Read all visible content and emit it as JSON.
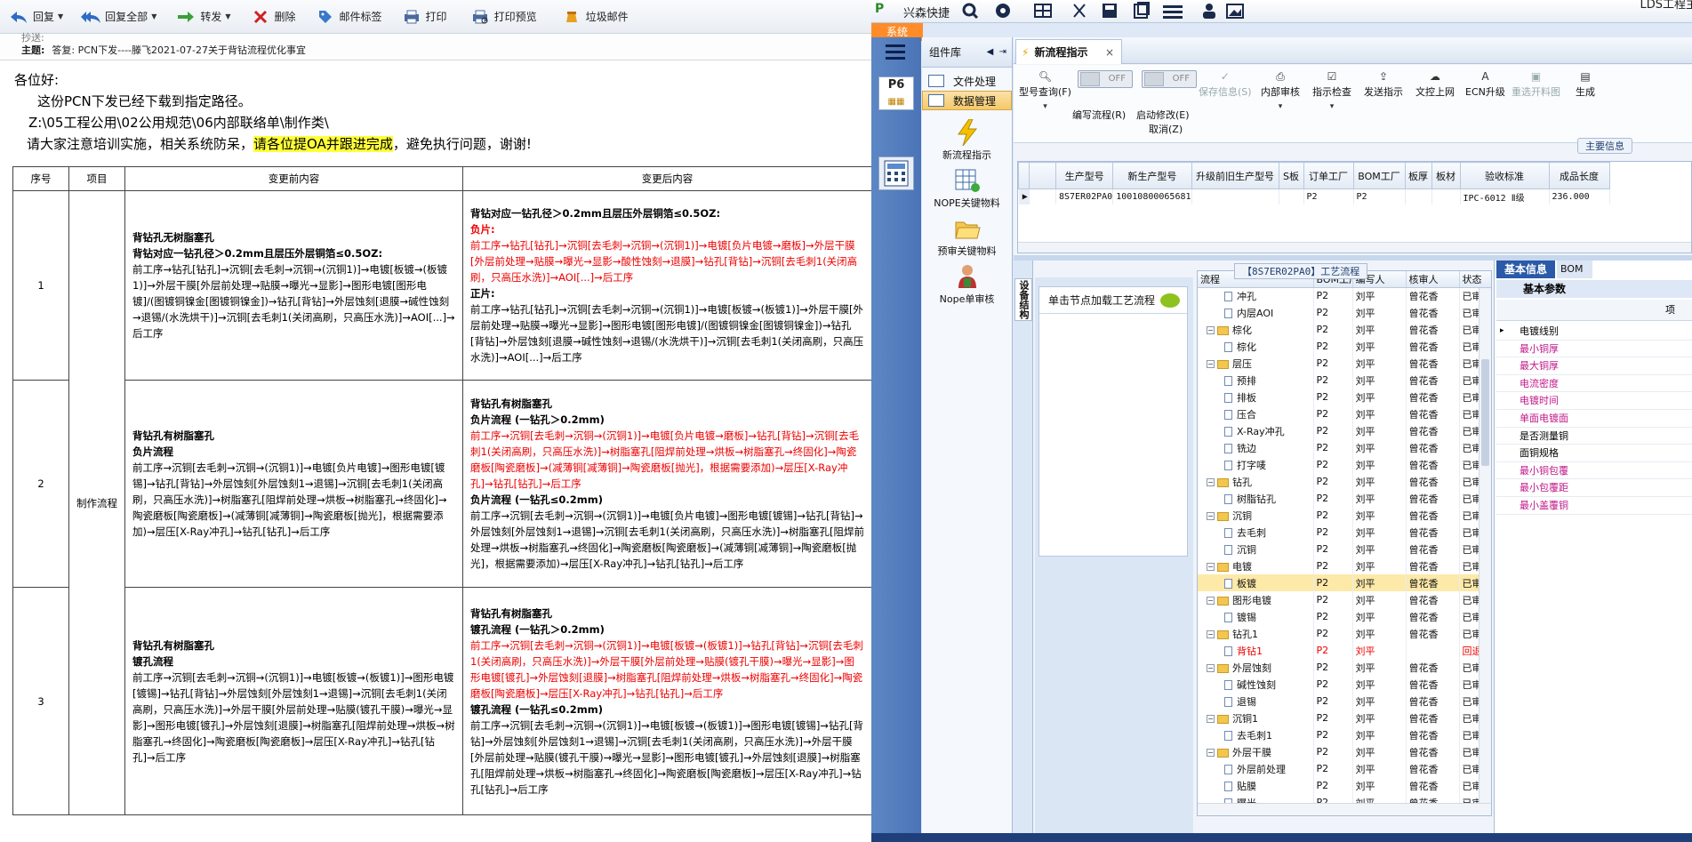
{
  "mail": {
    "toolbar": [
      {
        "label": "回复",
        "icon": "reply-icon",
        "dropdown": true
      },
      {
        "label": "回复全部",
        "icon": "reply-all-icon",
        "dropdown": true
      },
      {
        "label": "转发",
        "icon": "forward-icon",
        "dropdown": true
      },
      {
        "label": "删除",
        "icon": "delete-icon",
        "dropdown": false
      },
      {
        "label": "邮件标签",
        "icon": "tag-icon",
        "dropdown": false
      },
      {
        "label": "打印",
        "icon": "print-icon",
        "dropdown": false
      },
      {
        "label": "打印预览",
        "icon": "print-preview-icon",
        "dropdown": false
      },
      {
        "label": "垃圾邮件",
        "icon": "junk-icon",
        "dropdown": false
      }
    ],
    "subject_label": "主题:",
    "subject": "答复: PCN下发----滕飞2021-07-27关于背钻流程优化事宜",
    "greeting": "各位好:",
    "line1": "这份PCN下发已经下载到指定路径。",
    "line2": "Z:\\05工程公用\\02公用规范\\06内部联络单\\制作类\\",
    "line3_a": "请大家注意培训实施，相关系统防呆，",
    "line3_hl": "请各位提OA并跟进完成",
    "line3_b": "，避免执行问题，谢谢!",
    "table": {
      "headers": [
        "序号",
        "项目",
        "变更前内容",
        "变更后内容"
      ],
      "item_label": "制作流程",
      "rows": [
        {
          "num": "1",
          "before_title1": "背钻孔无树脂塞孔",
          "before_title2": "背钻对应一钻孔径＞0.2mm且层压外层铜箔≤0.5OZ:",
          "before_body": "前工序→钻孔[钻孔]→沉铜[去毛刺→沉铜→(沉铜1)]→电镀[板镀→(板镀1)]→外层干膜[外层前处理→贴膜→曝光→显影]→图形电镀[图形电镀]/(图镀铜镍金[图镀铜镍金])→钻孔[背钻]→外层蚀刻[退膜→碱性蚀刻→退锡/(水洗烘干)]→沉铜[去毛刺1(关闭高刷，只高压水洗)]→AOI[...]→后工序",
          "after_title1": "背钻对应一钻孔径＞0.2mm且层压外层铜箔≤0.5OZ:",
          "after_sub1": "负片:",
          "after_body1": "前工序→钻孔[钻孔]→沉铜[去毛刺→沉铜→(沉铜1)]→电镀[负片电镀→磨板]→外层干膜[外层前处理→贴膜→曝光→显影→酸性蚀刻→退膜]→钻孔[背钻]→沉铜[去毛刺1(关闭高刷，只高压水洗)]→AOI[...]→后工序",
          "after_sub2": "正片:",
          "after_body2": "前工序→钻孔[钻孔]→沉铜[去毛刺→沉铜→(沉铜1)]→电镀[板镀→(板镀1)]→外层干膜[外层前处理→贴膜→曝光→显影]→图形电镀[图形电镀]/(图镀铜镍金[图镀铜镍金])→钻孔[背钻]→外层蚀刻[退膜→碱性蚀刻→退锡/(水洗烘干)]→沉铜[去毛刺1(关闭高刷，只高压水洗)]→AOI[...]→后工序"
        },
        {
          "num": "2",
          "before_title1": "背钻孔有树脂塞孔",
          "before_title2": "负片流程",
          "before_body": "前工序→沉铜[去毛刺→沉铜→(沉铜1)]→电镀[负片电镀]→图形电镀[镀锡]→钻孔[背钻]→外层蚀刻[外层蚀刻1→退锡]→沉铜[去毛刺1(关闭高刷，只高压水洗)]→树脂塞孔[阻焊前处理→烘板→树脂塞孔→终固化]→陶瓷磨板[陶瓷磨板]→(减薄铜[减薄铜]→陶瓷磨板[抛光]，根据需要添加)→层压[X-Ray冲孔]→钻孔[钻孔]→后工序",
          "after_title1": "背钻孔有树脂塞孔",
          "after_sub1": "负片流程 (一钻孔＞0.2mm)",
          "after_body1": "前工序→沉铜[去毛刺→沉铜→(沉铜1)]→电镀[负片电镀→磨板]→钻孔[背钻]→沉铜[去毛刺1(关闭高刷，只高压水洗)]→树脂塞孔[阻焊前处理→烘板→树脂塞孔→终固化]→陶瓷磨板[陶瓷磨板]→(减薄铜[减薄铜]→陶瓷磨板[抛光]，根据需要添加)→层压[X-Ray冲孔]→钻孔[钻孔]→后工序",
          "after_sub2": "负片流程 (一钻孔≤0.2mm)",
          "after_body2": "前工序→沉铜[去毛刺→沉铜→(沉铜1)]→电镀[负片电镀]→图形电镀[镀锡]→钻孔[背钻]→外层蚀刻[外层蚀刻1→退锡]→沉铜[去毛刺1(关闭高刷，只高压水洗)]→树脂塞孔[阻焊前处理→烘板→树脂塞孔→终固化]→陶瓷磨板[陶瓷磨板]→(减薄铜[减薄铜]→陶瓷磨板[抛光]，根据需要添加)→层压[X-Ray冲孔]→钻孔[钻孔]→后工序"
        },
        {
          "num": "3",
          "before_title1": "背钻孔有树脂塞孔",
          "before_title2": "镀孔流程",
          "before_body": "前工序→沉铜[去毛刺→沉铜→(沉铜1)]→电镀[板镀→(板镀1)]→图形电镀[镀锡]→钻孔[背钻]→外层蚀刻[外层蚀刻1→退锡]→沉铜[去毛刺1(关闭高刷，只高压水洗)]→外层干膜[外层前处理→贴膜(镀孔干膜)→曝光→显影]→图形电镀[镀孔]→外层蚀刻[退膜]→树脂塞孔[阻焊前处理→烘板→树脂塞孔→终固化]→陶瓷磨板[陶瓷磨板]→层压[X-Ray冲孔]→钻孔[钻孔]→后工序",
          "after_title1": "背钻孔有树脂塞孔",
          "after_sub1": "镀孔流程 (一钻孔＞0.2mm)",
          "after_body1": "前工序→沉铜[去毛刺→沉铜→(沉铜1)]→电镀[板镀→(板镀1)]→钻孔[背钻]→沉铜[去毛刺1(关闭高刷，只高压水洗)]→外层干膜[外层前处理→贴膜(镀孔干膜)→曝光→显影]→图形电镀[镀孔]→外层蚀刻[退膜]→树脂塞孔[阻焊前处理→烘板→树脂塞孔→终固化]→陶瓷磨板[陶瓷磨板]→层压[X-Ray冲孔]→钻孔[钻孔]→后工序",
          "after_sub2": "镀孔流程 (一钻孔≤0.2mm)",
          "after_body2": "前工序→沉铜[去毛刺→沉铜→(沉铜1)]→电镀[板镀→(板镀1)]→图形电镀[镀锡]→钻孔[背钻]→外层蚀刻[外层蚀刻1→退锡]→沉铜[去毛刺1(关闭高刷，只高压水洗)]→外层干膜[外层前处理→贴膜(镀孔干膜)→曝光→显影]→图形电镀[镀孔]→外层蚀刻[退膜]→树脂塞孔[阻焊前处理→烘板→树脂塞孔→终固化]→陶瓷磨板[陶瓷磨板]→层压[X-Ray冲孔]→钻孔[钻孔]→后工序"
        }
      ]
    }
  },
  "erp": {
    "app_name": "兴森快捷",
    "corner_title": "LDS工程主",
    "sys_tab": "系统",
    "component_panel_title": "组件库",
    "component_items": [
      "文件处理",
      "数据管理"
    ],
    "component_big_items": [
      "新流程指示",
      "NOPE关键物料",
      "预审关键物料",
      "Nope单审核"
    ],
    "doc_tab": "新流程指示",
    "ribbon": {
      "model_query": "型号查询(F)",
      "edit_flow": "编写流程(R)",
      "enable_modify": "启动修改(E)",
      "cancel": "取消(Z)",
      "save": "保存信息(S)",
      "internal_review": "内部审核",
      "indicator_check": "指示检查",
      "send_indicator": "发送指示",
      "upload": "文控上网",
      "ecn_upgrade": "ECN升级",
      "re-select_image": "重选开料图",
      "generate": "生成",
      "off": "OFF"
    },
    "group_main": "主要信息",
    "grid_headers": [
      "生产型号",
      "新生产型号",
      "升级前旧生产型号",
      "S板",
      "订单工厂",
      "BOM工厂",
      "板厚",
      "板材",
      "验收标准",
      "成品长度"
    ],
    "grid_row": [
      "8S7ER02PA0",
      "10010800065681",
      "",
      "",
      "P2",
      "P2",
      "",
      "",
      "IPC-6012 Ⅱ级",
      "236.000"
    ],
    "vertical_tab": "设备结构",
    "node_hint": "单击节点加载工艺流程",
    "tree_title": "【8S7ER02PA0】工艺流程",
    "tree_headers": [
      "流程",
      "BOM工厂",
      "编写人",
      "核审人",
      "状态"
    ],
    "tree_rows": [
      {
        "level": 2,
        "kind": "file",
        "name": "冲孔",
        "bom": "P2",
        "writer": "刘平",
        "reviewer": "曾花香",
        "status": "已审核"
      },
      {
        "level": 2,
        "kind": "file",
        "name": "内层AOI",
        "bom": "P2",
        "writer": "刘平",
        "reviewer": "曾花香",
        "status": "已审核"
      },
      {
        "level": 1,
        "kind": "folder",
        "name": "棕化",
        "bom": "P2",
        "writer": "刘平",
        "reviewer": "曾花香",
        "status": "已审核"
      },
      {
        "level": 2,
        "kind": "file",
        "name": "棕化",
        "bom": "P2",
        "writer": "刘平",
        "reviewer": "曾花香",
        "status": "已审核"
      },
      {
        "level": 1,
        "kind": "folder",
        "name": "层压",
        "bom": "P2",
        "writer": "刘平",
        "reviewer": "曾花香",
        "status": "已审核"
      },
      {
        "level": 2,
        "kind": "file",
        "name": "预排",
        "bom": "P2",
        "writer": "刘平",
        "reviewer": "曾花香",
        "status": "已审核"
      },
      {
        "level": 2,
        "kind": "file",
        "name": "排板",
        "bom": "P2",
        "writer": "刘平",
        "reviewer": "曾花香",
        "status": "已审核"
      },
      {
        "level": 2,
        "kind": "file",
        "name": "压合",
        "bom": "P2",
        "writer": "刘平",
        "reviewer": "曾花香",
        "status": "已审核"
      },
      {
        "level": 2,
        "kind": "file",
        "name": "X-Ray冲孔",
        "bom": "P2",
        "writer": "刘平",
        "reviewer": "曾花香",
        "status": "已审核"
      },
      {
        "level": 2,
        "kind": "file",
        "name": "铣边",
        "bom": "P2",
        "writer": "刘平",
        "reviewer": "曾花香",
        "status": "已审核"
      },
      {
        "level": 2,
        "kind": "file",
        "name": "打字唛",
        "bom": "P2",
        "writer": "刘平",
        "reviewer": "曾花香",
        "status": "已审核"
      },
      {
        "level": 1,
        "kind": "folder",
        "name": "钻孔",
        "bom": "P2",
        "writer": "刘平",
        "reviewer": "曾花香",
        "status": "已审核"
      },
      {
        "level": 2,
        "kind": "file",
        "name": "树脂钻孔",
        "bom": "P2",
        "writer": "刘平",
        "reviewer": "曾花香",
        "status": "已审核"
      },
      {
        "level": 1,
        "kind": "folder",
        "name": "沉铜",
        "bom": "P2",
        "writer": "刘平",
        "reviewer": "曾花香",
        "status": "已审核"
      },
      {
        "level": 2,
        "kind": "file",
        "name": "去毛刺",
        "bom": "P2",
        "writer": "刘平",
        "reviewer": "曾花香",
        "status": "已审核"
      },
      {
        "level": 2,
        "kind": "file",
        "name": "沉铜",
        "bom": "P2",
        "writer": "刘平",
        "reviewer": "曾花香",
        "status": "已审核"
      },
      {
        "level": 1,
        "kind": "folder",
        "name": "电镀",
        "bom": "P2",
        "writer": "刘平",
        "reviewer": "曾花香",
        "status": "已审核"
      },
      {
        "level": 2,
        "kind": "file",
        "name": "板镀",
        "bom": "P2",
        "writer": "刘平",
        "reviewer": "曾花香",
        "status": "已审核",
        "selected": true
      },
      {
        "level": 1,
        "kind": "folder",
        "name": "图形电镀",
        "bom": "P2",
        "writer": "刘平",
        "reviewer": "曾花香",
        "status": "已审核"
      },
      {
        "level": 2,
        "kind": "file",
        "name": "镀锡",
        "bom": "P2",
        "writer": "刘平",
        "reviewer": "曾花香",
        "status": "已审核"
      },
      {
        "level": 1,
        "kind": "folder",
        "name": "钻孔1",
        "bom": "P2",
        "writer": "刘平",
        "reviewer": "曾花香",
        "status": "已审核"
      },
      {
        "level": 2,
        "kind": "file",
        "name": "背钻1",
        "bom": "P2",
        "writer": "刘平",
        "reviewer": "",
        "status": "回退",
        "back": true
      },
      {
        "level": 1,
        "kind": "folder",
        "name": "外层蚀刻",
        "bom": "P2",
        "writer": "刘平",
        "reviewer": "曾花香",
        "status": "已审核"
      },
      {
        "level": 2,
        "kind": "file",
        "name": "碱性蚀刻",
        "bom": "P2",
        "writer": "刘平",
        "reviewer": "曾花香",
        "status": "已审核"
      },
      {
        "level": 2,
        "kind": "file",
        "name": "退锡",
        "bom": "P2",
        "writer": "刘平",
        "reviewer": "曾花香",
        "status": "已审核"
      },
      {
        "level": 1,
        "kind": "folder",
        "name": "沉铜1",
        "bom": "P2",
        "writer": "刘平",
        "reviewer": "曾花香",
        "status": "已审核"
      },
      {
        "level": 2,
        "kind": "file",
        "name": "去毛刺1",
        "bom": "P2",
        "writer": "刘平",
        "reviewer": "曾花香",
        "status": "已审核"
      },
      {
        "level": 1,
        "kind": "folder",
        "name": "外层干膜",
        "bom": "P2",
        "writer": "刘平",
        "reviewer": "曾花香",
        "status": "已审核"
      },
      {
        "level": 2,
        "kind": "file",
        "name": "外层前处理",
        "bom": "P2",
        "writer": "刘平",
        "reviewer": "曾花香",
        "status": "已审核"
      },
      {
        "level": 2,
        "kind": "file",
        "name": "贴膜",
        "bom": "P2",
        "writer": "刘平",
        "reviewer": "曾花香",
        "status": "已审核"
      },
      {
        "level": 2,
        "kind": "file",
        "name": "曝光",
        "bom": "P2",
        "writer": "刘平",
        "reviewer": "曾花香",
        "status": "已审核"
      }
    ],
    "basic_tab": "基本信息",
    "basic_tab2": "BOM",
    "basic_header": "基本参数",
    "basic_col": "项",
    "basic_items": [
      {
        "label": "电镀线别",
        "pink": false
      },
      {
        "label": "最小铜厚",
        "pink": true
      },
      {
        "label": "最大铜厚",
        "pink": true
      },
      {
        "label": "电流密度",
        "pink": true
      },
      {
        "label": "电镀时间",
        "pink": true
      },
      {
        "label": "单面电镀面",
        "pink": true
      },
      {
        "label": "是否测量铜",
        "pink": false
      },
      {
        "label": "面铜规格",
        "pink": false
      },
      {
        "label": "最小铜包覆",
        "pink": true
      },
      {
        "label": "最小包覆距",
        "pink": true
      },
      {
        "label": "最小盖覆铜",
        "pink": true
      }
    ]
  }
}
